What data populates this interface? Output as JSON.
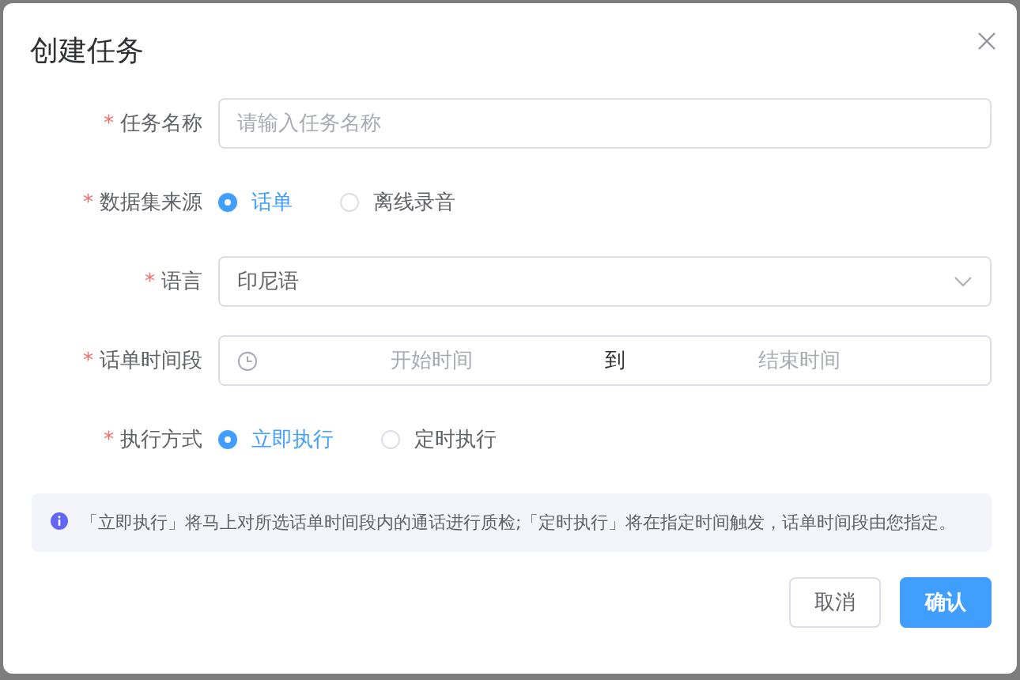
{
  "dialog": {
    "title": "创建任务"
  },
  "fields": [
    {
      "kind": "text",
      "required_mark": "*",
      "label": "任务名称",
      "placeholder": "请输入任务名称"
    },
    {
      "kind": "radio",
      "required_mark": "*",
      "label": "数据集来源",
      "options": [
        {
          "label": "话单",
          "selected": true
        },
        {
          "label": "离线录音",
          "selected": false
        }
      ]
    },
    {
      "kind": "select",
      "required_mark": "*",
      "label": "语言",
      "value": "印尼语"
    },
    {
      "kind": "daterange",
      "required_mark": "*",
      "label": "话单时间段",
      "start_placeholder": "开始时间",
      "separator": "到",
      "end_placeholder": "结束时间"
    },
    {
      "kind": "radio",
      "required_mark": "*",
      "label": "执行方式",
      "options": [
        {
          "label": "立即执行",
          "selected": true
        },
        {
          "label": "定时执行",
          "selected": false
        }
      ]
    }
  ],
  "info": "「立即执行」将马上对所选话单时间段内的通话进行质检;「定时执行」将在指定时间触发，话单时间段由您指定。",
  "buttons": [
    {
      "label": "取消",
      "kind": "default"
    },
    {
      "label": "确认",
      "kind": "primary"
    }
  ]
}
